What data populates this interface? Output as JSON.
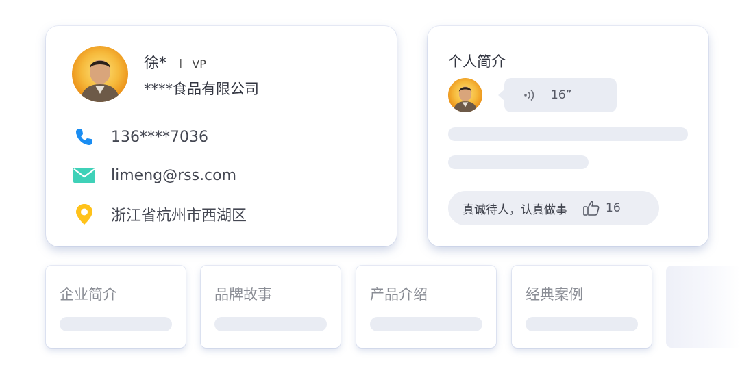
{
  "profile": {
    "name": "徐*",
    "separator": "I",
    "title": "VP",
    "company": "****食品有限公司",
    "phone": "136****7036",
    "email": "limeng@rss.com",
    "address": "浙江省杭州市西湖区"
  },
  "intro": {
    "title": "个人简介",
    "voice_duration": "16”",
    "motto": "真诚待人，认真做事",
    "likes": "16"
  },
  "tiles": [
    {
      "label": "企业简介"
    },
    {
      "label": "品牌故事"
    },
    {
      "label": "产品介绍"
    },
    {
      "label": "经典案例"
    }
  ],
  "icons": {
    "phone": "phone-icon",
    "email": "mail-icon",
    "address": "location-pin-icon",
    "voice": "sound-wave-icon",
    "like": "thumbs-up-icon"
  },
  "colors": {
    "phone_icon": "#1a8df2",
    "mail_icon": "#3fd1b8",
    "pin_icon": "#ffc21a",
    "skeleton": "#e9ecf3",
    "card_shadow": "#7b8cbe"
  }
}
